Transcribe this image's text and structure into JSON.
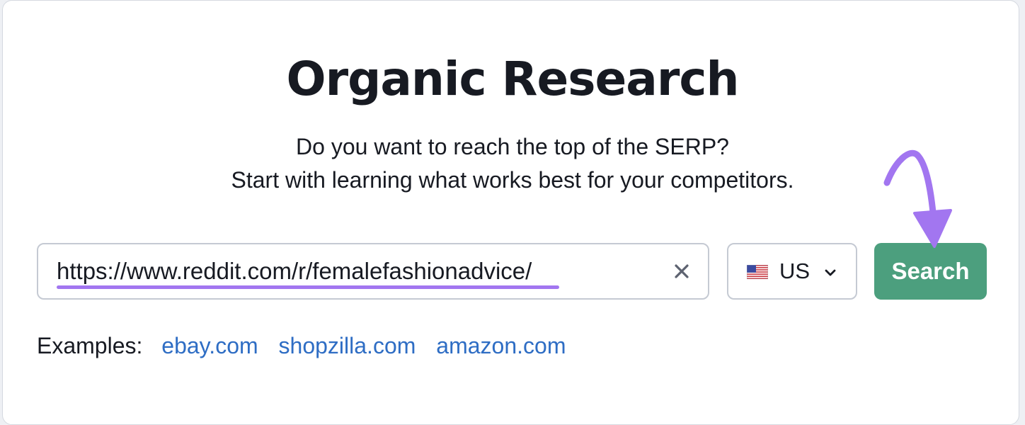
{
  "header": {
    "title": "Organic Research",
    "subtitle_line1": "Do you want to reach the top of the SERP?",
    "subtitle_line2": "Start with learning what works best for your competitors."
  },
  "search": {
    "value": "https://www.reddit.com/r/femalefashionadvice/",
    "clear_icon": "close-icon"
  },
  "country": {
    "flag_icon": "us-flag-icon",
    "selected": "US",
    "chevron_icon": "chevron-down-icon"
  },
  "search_button": {
    "label": "Search"
  },
  "examples": {
    "label": "Examples:",
    "links": [
      "ebay.com",
      "shopzilla.com",
      "amazon.com"
    ]
  },
  "colors": {
    "accent_button": "#4c9f7e",
    "link": "#2e6dc4",
    "annotation": "#a276f0",
    "text": "#171a22"
  }
}
